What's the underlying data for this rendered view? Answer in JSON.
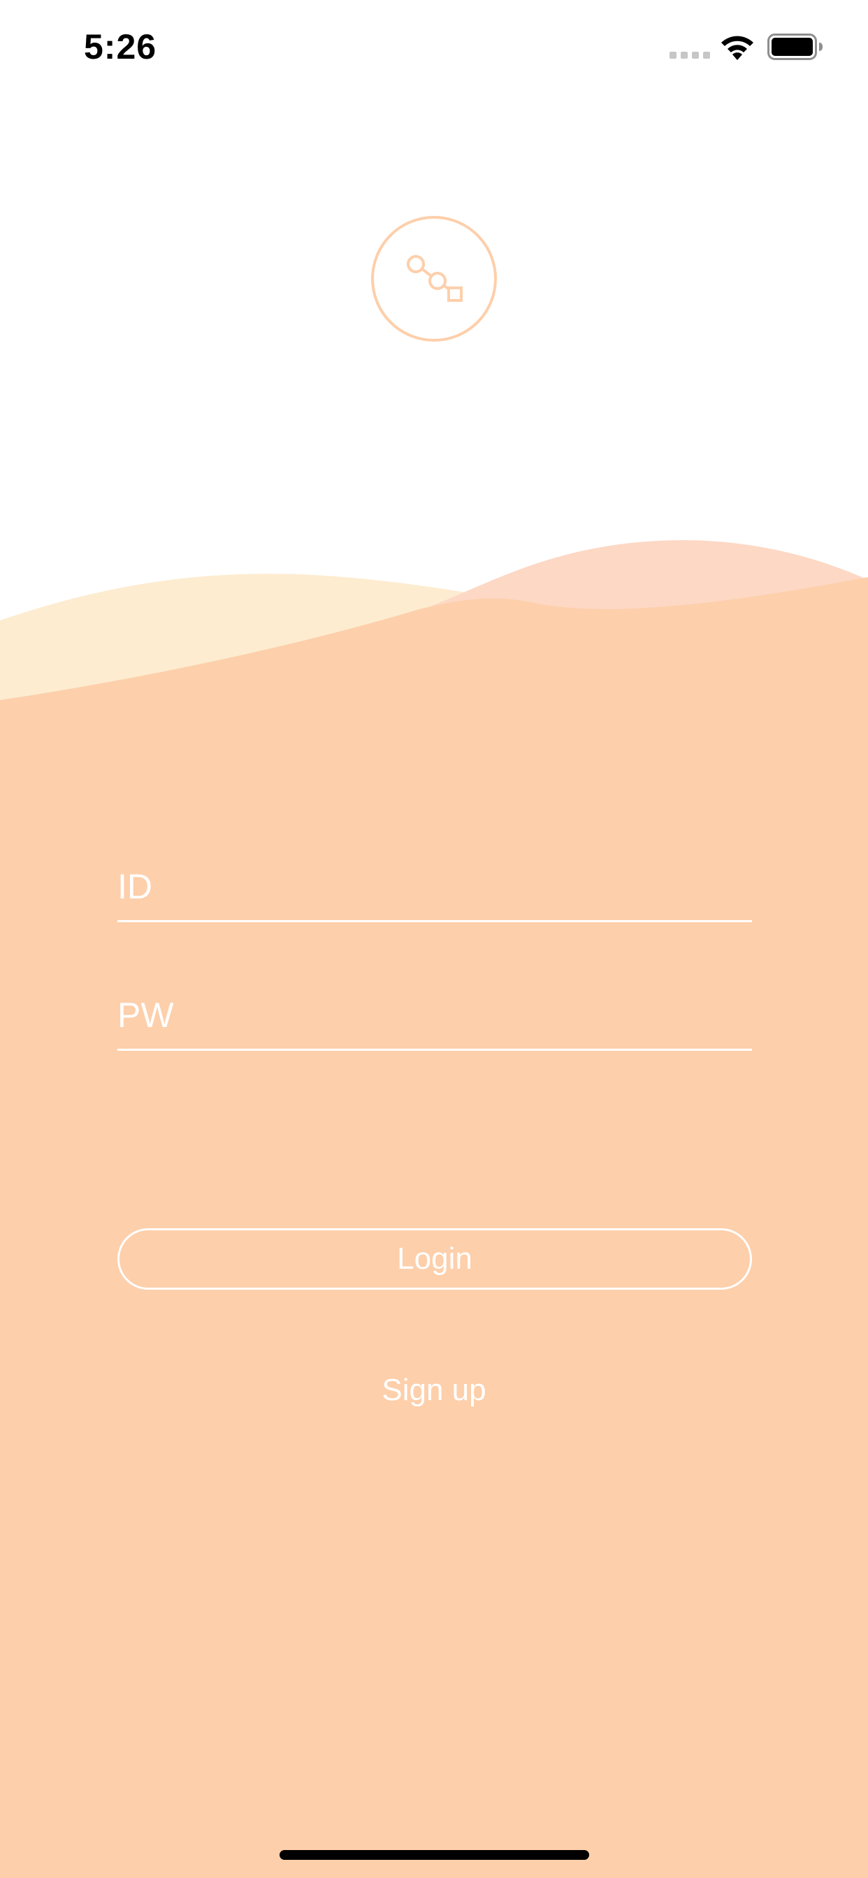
{
  "status_bar": {
    "time": "5:26",
    "signal_icon": "cellular-signal-icon",
    "wifi_icon": "wifi-icon",
    "battery_icon": "battery-icon"
  },
  "logo": {
    "icon": "connected-nodes-icon"
  },
  "form": {
    "id_placeholder": "ID",
    "id_value": "",
    "pw_placeholder": "PW",
    "pw_value": ""
  },
  "actions": {
    "login_label": "Login",
    "signup_label": "Sign up"
  },
  "colors": {
    "background": "#ffffff",
    "primary_peach": "#fdcfab",
    "wave_light_yellow": "#fdecd0",
    "wave_pink": "#fdd8c4",
    "text_on_peach": "#ffffff"
  }
}
